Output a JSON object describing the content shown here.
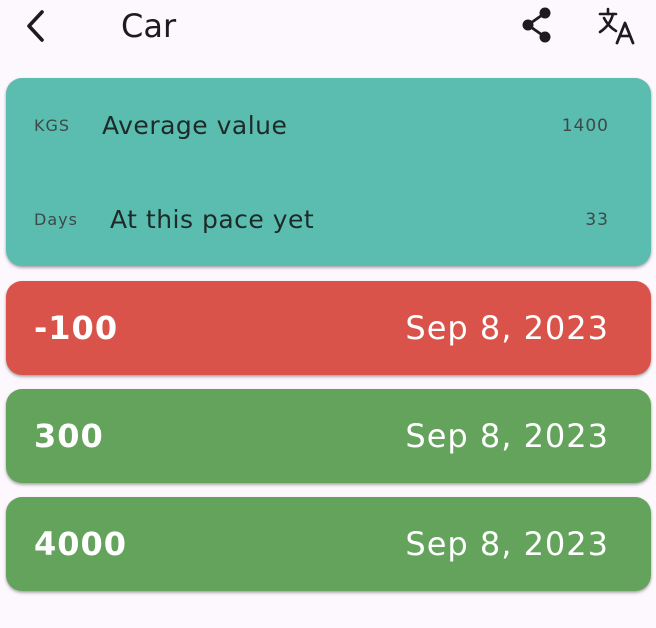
{
  "appbar": {
    "title": "Car",
    "back_icon": "chevron-left-icon",
    "share_icon": "share-icon",
    "translate_icon": "translate-icon"
  },
  "summary": {
    "average": {
      "unit": "KGS",
      "label": "Average value",
      "value": "1400"
    },
    "pace": {
      "unit": "Days",
      "label": "At this pace yet",
      "value": "33"
    },
    "color": "#5bbcb0"
  },
  "entries": [
    {
      "amount": "-100",
      "date": "Sep 8, 2023",
      "color": "#d9534a"
    },
    {
      "amount": "300",
      "date": "Sep 8, 2023",
      "color": "#63a35c"
    },
    {
      "amount": "4000",
      "date": "Sep 8, 2023",
      "color": "#63a35c"
    }
  ],
  "colors": {
    "background": "#fdf8fd",
    "summary": "#5bbcb0",
    "negative": "#d9534a",
    "positive": "#63a35c"
  }
}
